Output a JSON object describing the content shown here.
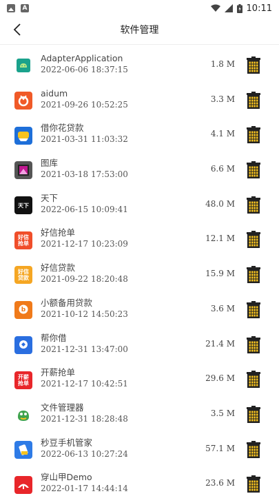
{
  "status": {
    "time": "10:11"
  },
  "header": {
    "title": "软件管理"
  },
  "apps": [
    {
      "name": "AdapterApplication",
      "date": "2022-06-06 18:37:15",
      "size": "1.8 M",
      "icon": "android-icon",
      "bg": "#ffffff",
      "glyph": ""
    },
    {
      "name": "aidum",
      "date": "2021-09-26 10:52:25",
      "size": "3.3 M",
      "icon": "aidum-icon",
      "bg": "#f05a28",
      "glyph": ""
    },
    {
      "name": "借你花贷款",
      "date": "2021-03-31 11:03:32",
      "size": "4.1 M",
      "icon": "jienihua-icon",
      "bg": "#1e6fd9",
      "glyph": ""
    },
    {
      "name": "图库",
      "date": "2021-03-18 17:53:00",
      "size": "6.6 M",
      "icon": "gallery-icon",
      "bg": "#555555",
      "glyph": ""
    },
    {
      "name": "天下",
      "date": "2022-06-15 10:09:41",
      "size": "48.0 M",
      "icon": "tianxia-icon",
      "bg": "#111111",
      "glyph": "天下"
    },
    {
      "name": "好信抢单",
      "date": "2021-12-17 10:23:09",
      "size": "12.1 M",
      "icon": "haoxin-qiangdan-icon",
      "bg": "#f04e2a",
      "glyph": "好信抢单"
    },
    {
      "name": "好信贷款",
      "date": "2021-09-22 18:20:48",
      "size": "15.9 M",
      "icon": "haoxin-daikuan-icon",
      "bg": "#f5a623",
      "glyph": "好信贷款"
    },
    {
      "name": "小额备用贷款",
      "date": "2021-10-12 14:50:23",
      "size": "3.6 M",
      "icon": "xiaoe-icon",
      "bg": "#f07a1a",
      "glyph": ""
    },
    {
      "name": "帮你借",
      "date": "2021-12-31 13:47:00",
      "size": "21.4 M",
      "icon": "bangnijie-icon",
      "bg": "#2a6ee0",
      "glyph": ""
    },
    {
      "name": "开薪抢单",
      "date": "2021-12-17 10:42:51",
      "size": "29.6 M",
      "icon": "kaixin-icon",
      "bg": "#e8262a",
      "glyph": "开薪抢单"
    },
    {
      "name": "文件管理器",
      "date": "2021-12-31 18:28:48",
      "size": "3.5 M",
      "icon": "file-manager-icon",
      "bg": "#ffffff",
      "glyph": ""
    },
    {
      "name": "秒豆手机管家",
      "date": "2022-06-13 10:27:24",
      "size": "57.1 M",
      "icon": "miaodou-icon",
      "bg": "#2e7be6",
      "glyph": ""
    },
    {
      "name": "穿山甲Demo",
      "date": "2022-01-17 14:44:14",
      "size": "23.6 M",
      "icon": "chuanshanjia-icon",
      "bg": "#e8262a",
      "glyph": ""
    }
  ]
}
